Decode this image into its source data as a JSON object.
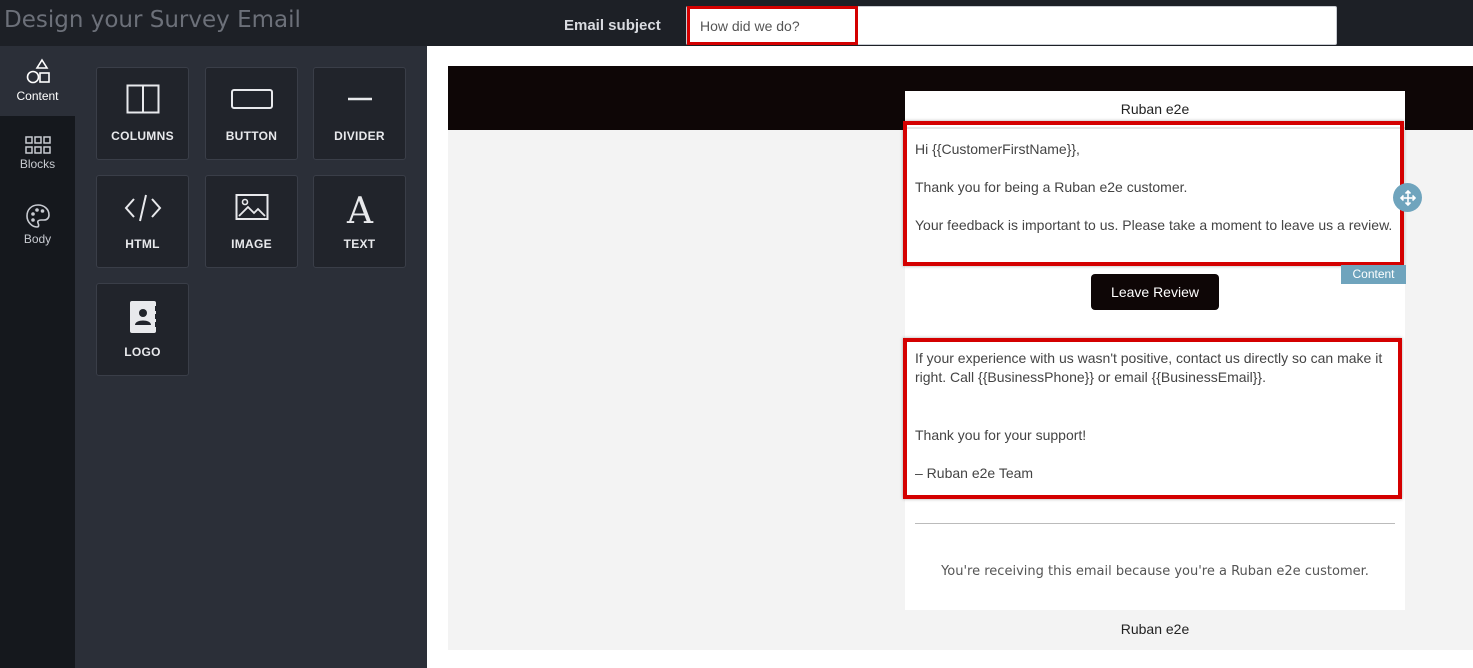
{
  "app": {
    "title": "Design your Survey Email"
  },
  "subject": {
    "label": "Email subject",
    "value": "How did we do?"
  },
  "sidenav": [
    {
      "label": "Content",
      "icon": "shapes-icon",
      "active": true
    },
    {
      "label": "Blocks",
      "icon": "grid-icon",
      "active": false
    },
    {
      "label": "Body",
      "icon": "palette-icon",
      "active": false
    }
  ],
  "tools": [
    {
      "label": "COLUMNS",
      "icon": "columns-icon"
    },
    {
      "label": "BUTTON",
      "icon": "button-icon"
    },
    {
      "label": "DIVIDER",
      "icon": "divider-icon"
    },
    {
      "label": "HTML",
      "icon": "code-icon"
    },
    {
      "label": "IMAGE",
      "icon": "image-icon"
    },
    {
      "label": "TEXT",
      "icon": "text-icon"
    },
    {
      "label": "LOGO",
      "icon": "contact-book-icon"
    }
  ],
  "email": {
    "brand_top": "Ruban e2e",
    "greeting": "Hi {{CustomerFirstName}},",
    "thanks": "Thank you for being a Ruban e2e customer.",
    "feedback": "Your feedback is important to us. Please take a moment to leave us a review.",
    "button_label": "Leave Review",
    "badge": "Content",
    "negative": "If your experience with us wasn't positive, contact us directly so can make it right. Call {{BusinessPhone}} or email {{BusinessEmail}}.",
    "support": "Thank you for your support!",
    "signature": "– Ruban e2e Team",
    "footer_note": "You're receiving this email because you're a Ruban e2e customer.",
    "brand_bottom": "Ruban e2e"
  },
  "colors": {
    "highlight": "#d40000",
    "header_band": "#0e0606",
    "badge": "#6fa4bd",
    "panel": "#2b2f38"
  }
}
